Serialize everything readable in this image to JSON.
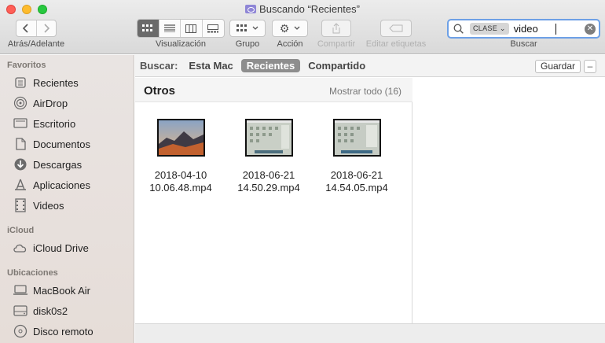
{
  "window": {
    "title": "Buscando “Recientes”",
    "folder_icon": "smart-folder-icon"
  },
  "toolbar": {
    "nav_label": "Atrás/Adelante",
    "view_label": "Visualización",
    "group_label": "Grupo",
    "action_label": "Acción",
    "share_label": "Compartir",
    "tags_label": "Editar etiquetas",
    "search_label": "Buscar",
    "active_view": "icon-view"
  },
  "search": {
    "token": "CLASE",
    "query": "video"
  },
  "sidebar": {
    "favorites_heading": "Favoritos",
    "favorites": [
      {
        "label": "Recientes",
        "icon": "recents-icon"
      },
      {
        "label": "AirDrop",
        "icon": "airdrop-icon"
      },
      {
        "label": "Escritorio",
        "icon": "desktop-icon"
      },
      {
        "label": "Documentos",
        "icon": "documents-icon"
      },
      {
        "label": "Descargas",
        "icon": "downloads-icon"
      },
      {
        "label": "Aplicaciones",
        "icon": "applications-icon"
      },
      {
        "label": "Videos",
        "icon": "film-icon"
      }
    ],
    "icloud_heading": "iCloud",
    "icloud": [
      {
        "label": "iCloud Drive",
        "icon": "cloud-icon"
      }
    ],
    "locations_heading": "Ubicaciones",
    "locations": [
      {
        "label": "MacBook Air",
        "icon": "laptop-icon"
      },
      {
        "label": "disk0s2",
        "icon": "disk-icon"
      },
      {
        "label": "Disco remoto",
        "icon": "remote-disc-icon"
      }
    ]
  },
  "scope": {
    "label": "Buscar:",
    "options": [
      "Esta Mac",
      "Recientes",
      "Compartido"
    ],
    "active": "Recientes",
    "save_label": "Guardar",
    "remove_label": "–"
  },
  "results": {
    "group_title": "Otros",
    "show_all": "Mostrar todo (16)",
    "files": [
      {
        "line1": "2018-04-10",
        "line2": "10.06.48.mp4",
        "thumb": "mountain-wallpaper"
      },
      {
        "line1": "2018-06-21",
        "line2": "14.50.29.mp4",
        "thumb": "desktop-screenshot"
      },
      {
        "line1": "2018-06-21",
        "line2": "14.54.05.mp4",
        "thumb": "desktop-screenshot"
      }
    ]
  }
}
